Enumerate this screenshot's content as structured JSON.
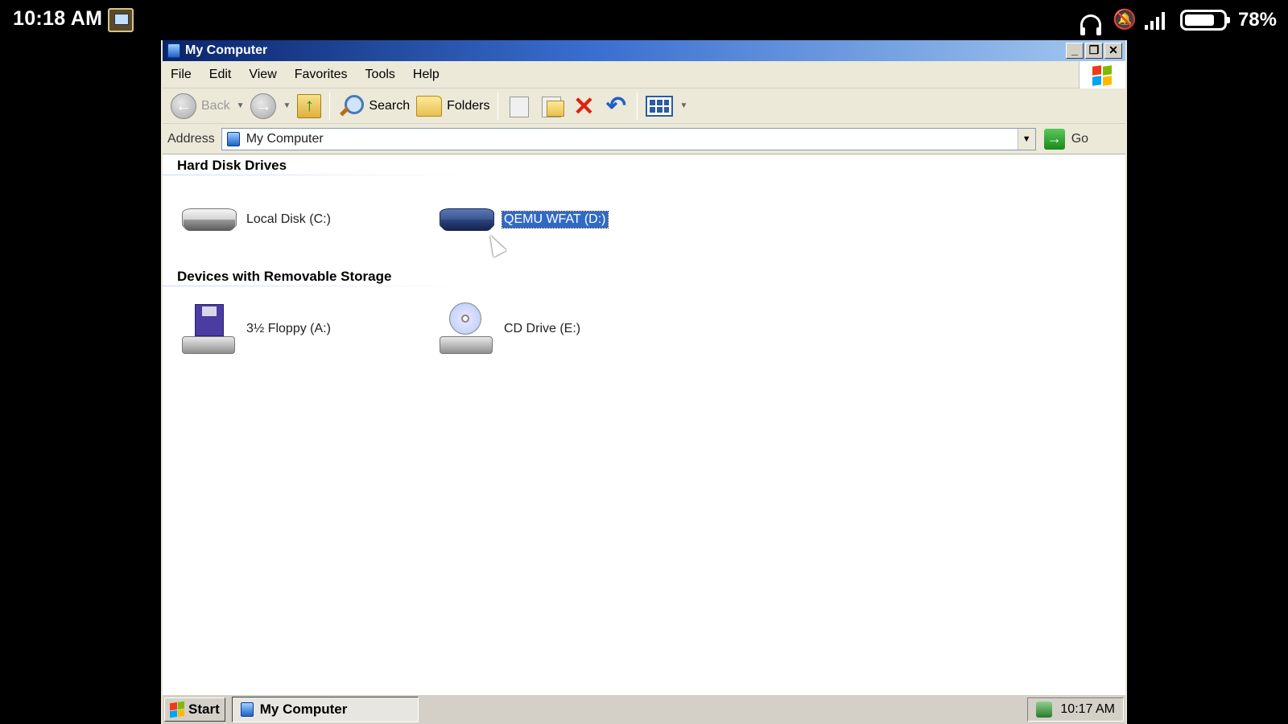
{
  "android_status": {
    "time": "10:18 AM",
    "battery": "78%",
    "battery_level": 0.78
  },
  "window": {
    "title": "My Computer"
  },
  "menu": [
    "File",
    "Edit",
    "View",
    "Favorites",
    "Tools",
    "Help"
  ],
  "toolbar": {
    "back": "Back",
    "search": "Search",
    "folders": "Folders"
  },
  "address": {
    "label": "Address",
    "value": "My Computer",
    "go": "Go"
  },
  "groups": {
    "hard_disks": {
      "title": "Hard Disk Drives",
      "items": [
        "Local Disk (C:)",
        "QEMU WFAT (D:)"
      ]
    },
    "removable": {
      "title": "Devices with Removable Storage",
      "items": [
        "3½ Floppy (A:)",
        "CD Drive (E:)"
      ]
    }
  },
  "taskbar": {
    "start": "Start",
    "task": "My Computer",
    "clock": "10:17 AM"
  },
  "colors": {
    "selection": "#316ac5",
    "titlebar": "#0a246a"
  }
}
